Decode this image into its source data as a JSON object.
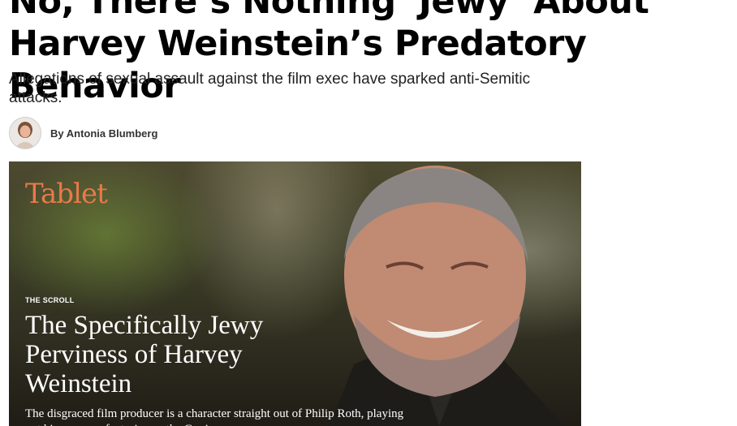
{
  "article": {
    "headline": "No, There’s Nothing ‘Jewy’ About Harvey Weinstein’s Predatory Behavior",
    "dek": "Allegations of sexual assault against the film exec have sparked anti-Semitic attacks.",
    "byline": "By Antonia Blumberg"
  },
  "hero_image": {
    "brand": "Tablet",
    "kicker": "THE SCROLL",
    "title": "The Specifically Jewy Perviness of Harvey Weinstein",
    "dek": "The disgraced film producer is a character straight out of Philip Roth, playing out his perverse fantasies on the Goyim"
  },
  "colors": {
    "brand": "#e87a48"
  }
}
